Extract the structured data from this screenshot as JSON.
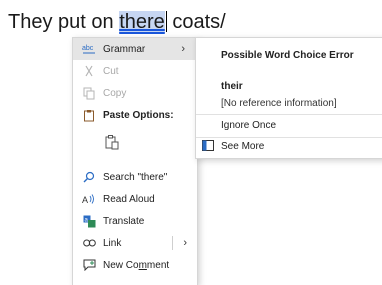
{
  "document": {
    "before": "They put on ",
    "highlighted_word": "there",
    "after": " coats/"
  },
  "context_menu": {
    "grammar": "Grammar",
    "cut": "Cut",
    "copy": "Copy",
    "paste_options": "Paste Options:",
    "search": "Search \"there\"",
    "read_aloud": "Read Aloud",
    "translate": "Translate",
    "link": "Link",
    "new_comment": "New Comment"
  },
  "submenu": {
    "title": "Possible Word Choice Error",
    "suggestion": "their",
    "info": "[No reference information]",
    "ignore_once": "Ignore Once",
    "see_more": "See More",
    "more_marker": ":"
  },
  "colors": {
    "highlight": "#c7d6f2",
    "active_item": "#e5e5e5",
    "icon_blue": "#2b6cc4",
    "icon_green": "#2e8b57"
  }
}
